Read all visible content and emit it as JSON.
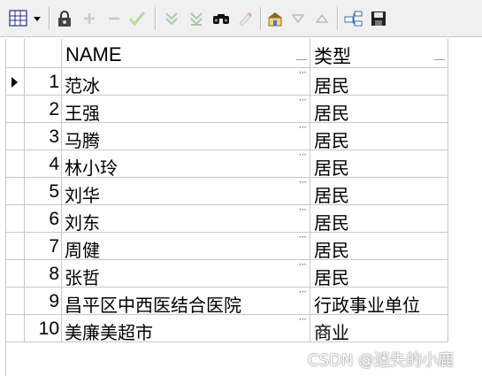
{
  "toolbar": {
    "icons": [
      "grid-view-icon",
      "dropdown-icon",
      "lock-icon",
      "add-icon",
      "remove-icon",
      "check-icon",
      "filter-icon",
      "clear-filter-icon",
      "find-icon",
      "edit-icon",
      "refresh-icon",
      "sort-descending-icon",
      "sort-ascending-icon",
      "query-icon",
      "save-icon"
    ]
  },
  "columns": {
    "name": "NAME",
    "type": "类型"
  },
  "rows": [
    {
      "num": "1",
      "name": "范冰",
      "type": "居民"
    },
    {
      "num": "2",
      "name": "王强",
      "type": "居民"
    },
    {
      "num": "3",
      "name": "马腾",
      "type": "居民"
    },
    {
      "num": "4",
      "name": "林小玲",
      "type": "居民"
    },
    {
      "num": "5",
      "name": "刘华",
      "type": "居民"
    },
    {
      "num": "6",
      "name": "刘东",
      "type": "居民"
    },
    {
      "num": "7",
      "name": "周健",
      "type": "居民"
    },
    {
      "num": "8",
      "name": "张哲",
      "type": "居民"
    },
    {
      "num": "9",
      "name": "昌平区中西医结合医院",
      "type": "行政事业单位"
    },
    {
      "num": "10",
      "name": "美廉美超市",
      "type": "商业"
    }
  ],
  "watermark": "CSDN @迷失的小鹿",
  "colors": {
    "grid_line": "#c8c8c8",
    "toolbar_bg": "#f0f0f0"
  }
}
